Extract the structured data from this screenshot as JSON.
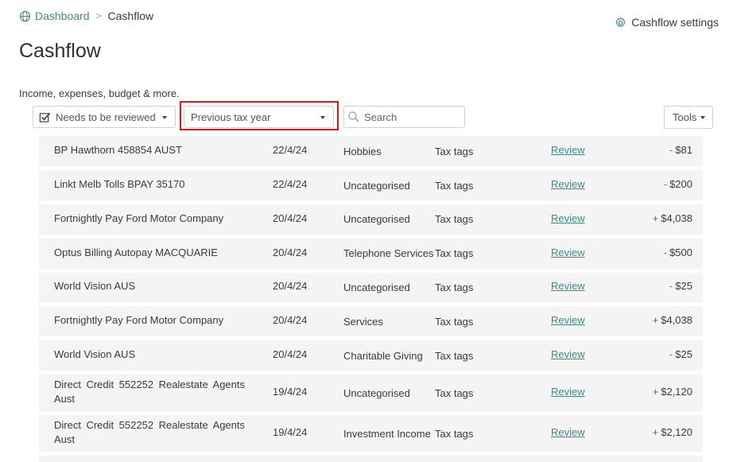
{
  "breadcrumb": {
    "root": "Dashboard",
    "separator": ">",
    "current": "Cashflow"
  },
  "settings_label": "Cashflow settings",
  "page": {
    "title": "Cashflow",
    "subtitle": "Income, expenses, budget & more."
  },
  "filters": {
    "review_filter": "Needs to be reviewed",
    "period_filter": "Previous tax year",
    "search_placeholder": "Search",
    "tools_label": "Tools"
  },
  "colors": {
    "accent": "#3f8a88",
    "highlight": "#e0141b",
    "negative": "#d9534f",
    "positive": "#2f7a5a"
  },
  "transactions": [
    {
      "name": "BP Hawthorn 458854 AUST",
      "date": "22/4/24",
      "category": "Hobbies",
      "tags": "Tax tags",
      "action": "Review",
      "sign": "-",
      "amount": "$81"
    },
    {
      "name": "Linkt Melb Tolls BPAY 35170",
      "date": "22/4/24",
      "category": "Uncategorised",
      "tags": "Tax tags",
      "action": "Review",
      "sign": "-",
      "amount": "$200"
    },
    {
      "name": "Fortnightly Pay Ford Motor Company",
      "date": "20/4/24",
      "category": "Uncategorised",
      "tags": "Tax tags",
      "action": "Review",
      "sign": "+",
      "amount": "$4,038"
    },
    {
      "name": "Optus Billing Autopay MACQUARIE",
      "date": "20/4/24",
      "category": "Telephone Services",
      "tags": "Tax tags",
      "action": "Review",
      "sign": "-",
      "amount": "$500"
    },
    {
      "name": "World Vision AUS",
      "date": "20/4/24",
      "category": "Uncategorised",
      "tags": "Tax tags",
      "action": "Review",
      "sign": "-",
      "amount": "$25"
    },
    {
      "name": "Fortnightly Pay Ford Motor Company",
      "date": "20/4/24",
      "category": "Services",
      "tags": "Tax tags",
      "action": "Review",
      "sign": "+",
      "amount": "$4,038"
    },
    {
      "name": "World Vision AUS",
      "date": "20/4/24",
      "category": "Charitable Giving",
      "tags": "Tax tags",
      "action": "Review",
      "sign": "-",
      "amount": "$25"
    },
    {
      "name": "Direct Credit 552252 Realestate Agents Aust",
      "date": "19/4/24",
      "category": "Uncategorised",
      "tags": "Tax tags",
      "action": "Review",
      "sign": "+",
      "amount": "$2,120"
    },
    {
      "name": "Direct Credit 552252 Realestate Agents Aust",
      "date": "19/4/24",
      "category": "Investment Income",
      "tags": "Tax tags",
      "action": "Review",
      "sign": "+",
      "amount": "$2,120"
    }
  ]
}
